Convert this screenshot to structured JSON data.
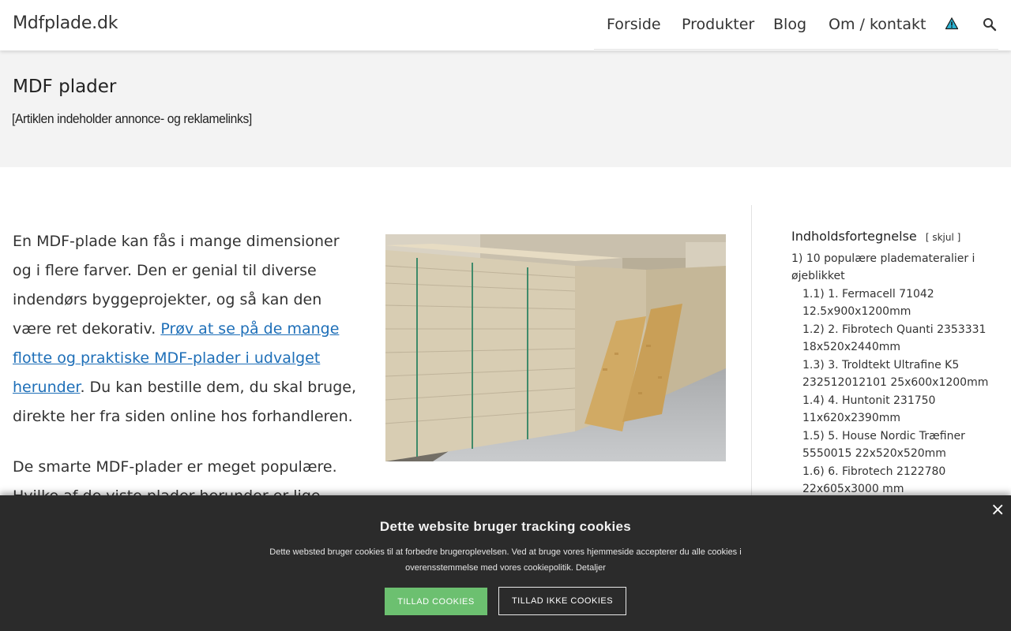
{
  "header": {
    "site_title": "Mdfplade.dk",
    "nav": [
      {
        "label": "Forside"
      },
      {
        "label": "Produkter"
      },
      {
        "label": "Blog"
      },
      {
        "label": "Om / kontakt"
      }
    ],
    "icons": [
      "warning-icon",
      "search-icon"
    ]
  },
  "page": {
    "title": "MDF plader",
    "disclaimer": "[Artiklen indeholder annonce- og reklamelinks]"
  },
  "content": {
    "intro_before_link": "En MDF-plade kan fås i mange dimensioner og i flere farver. Den er genial til diverse indendørs byggeprojekter, og så kan den være ret dekorativ. ",
    "intro_link": "Prøv at se på de mange flotte og praktiske MDF-plader i udvalget herunder",
    "intro_after_link": ". Du kan bestille dem, du skal bruge, direkte her fra siden online hos forhandleren.",
    "second_paragraph": "De smarte MDF-plader er meget populære. Hvilke af de viste plader herunder er lige dem"
  },
  "toc": {
    "title": "Indholdsfortegnelse",
    "toggle": "skjul",
    "items": [
      {
        "num": "1)",
        "text": "10 populære plademateralier i øjeblikket"
      },
      {
        "num": "1.1)",
        "text": "1. Fermacell 71042 12.5x900x1200mm"
      },
      {
        "num": "1.2)",
        "text": "2. Fibrotech Quanti 2353331 18x520x2440mm"
      },
      {
        "num": "1.3)",
        "text": "3. Troldtekt Ultrafine K5 232512012101 25x600x1200mm"
      },
      {
        "num": "1.4)",
        "text": "4. Huntonit 231750 11x620x2390mm"
      },
      {
        "num": "1.5)",
        "text": "5. House Nordic Træfiner 5550015 22x520x520mm"
      },
      {
        "num": "1.6)",
        "text": "6. Fibrotech 2122780 22x605x3000 mm"
      }
    ]
  },
  "cookie": {
    "title": "Dette website bruger tracking cookies",
    "text": "Dette websted bruger cookies til at forbedre brugeroplevelsen. Ved at bruge vores hjemmeside accepterer du alle cookies i overensstemmelse med vores cookiepolitik.",
    "details_link": "Detaljer",
    "allow_label": "TILLAD COOKIES",
    "deny_label": "TILLAD IKKE COOKIES",
    "close_label": "×"
  },
  "colors": {
    "link": "#1e6fb8",
    "title_band": "#f3f3f3",
    "cookie_bg": "#2b2b2b",
    "allow_button": "#6cc070",
    "warning_icon": "#2bb4d4"
  }
}
